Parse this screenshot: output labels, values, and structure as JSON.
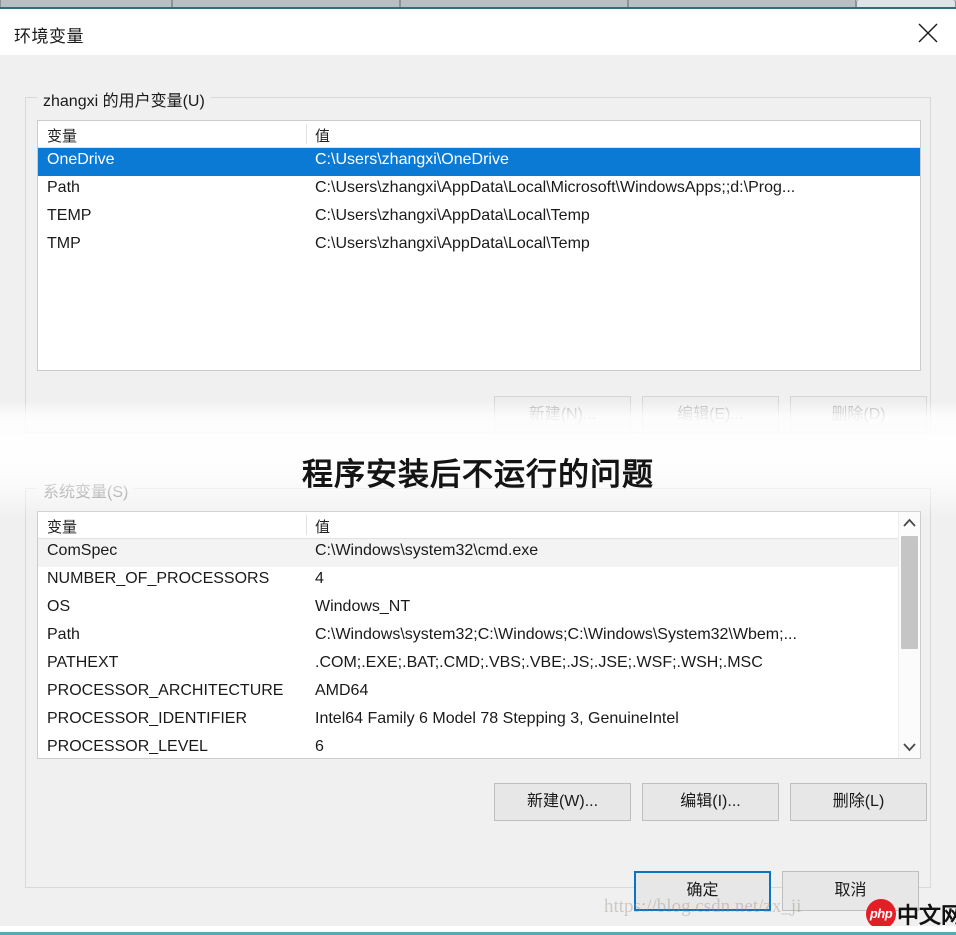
{
  "window": {
    "title": "环境变量",
    "close_icon": "close-icon"
  },
  "user_section": {
    "legend": "zhangxi 的用户变量(U)",
    "columns": [
      "变量",
      "值"
    ],
    "rows": [
      {
        "name": "OneDrive",
        "value": "C:\\Users\\zhangxi\\OneDrive",
        "selected": true
      },
      {
        "name": "Path",
        "value": "C:\\Users\\zhangxi\\AppData\\Local\\Microsoft\\WindowsApps;;d:\\Prog...",
        "selected": false
      },
      {
        "name": "TEMP",
        "value": "C:\\Users\\zhangxi\\AppData\\Local\\Temp",
        "selected": false
      },
      {
        "name": "TMP",
        "value": "C:\\Users\\zhangxi\\AppData\\Local\\Temp",
        "selected": false
      }
    ],
    "buttons": {
      "new": "新建(N)...",
      "edit": "编辑(E)...",
      "delete": "删除(D)"
    }
  },
  "system_section": {
    "legend": "系统变量(S)",
    "columns": [
      "变量",
      "值"
    ],
    "rows": [
      {
        "name": "ComSpec",
        "value": "C:\\Windows\\system32\\cmd.exe",
        "alt": true
      },
      {
        "name": "NUMBER_OF_PROCESSORS",
        "value": "4",
        "alt": false
      },
      {
        "name": "OS",
        "value": "Windows_NT",
        "alt": false
      },
      {
        "name": "Path",
        "value": "C:\\Windows\\system32;C:\\Windows;C:\\Windows\\System32\\Wbem;...",
        "alt": false
      },
      {
        "name": "PATHEXT",
        "value": ".COM;.EXE;.BAT;.CMD;.VBS;.VBE;.JS;.JSE;.WSF;.WSH;.MSC",
        "alt": false
      },
      {
        "name": "PROCESSOR_ARCHITECTURE",
        "value": "AMD64",
        "alt": false
      },
      {
        "name": "PROCESSOR_IDENTIFIER",
        "value": "Intel64 Family 6 Model 78 Stepping 3, GenuineIntel",
        "alt": false
      },
      {
        "name": "PROCESSOR_LEVEL",
        "value": "6",
        "alt": false
      }
    ],
    "buttons": {
      "new": "新建(W)...",
      "edit": "编辑(I)...",
      "delete": "删除(L)"
    },
    "scrollbar": {
      "up_icon": "chevron-up-icon",
      "down_icon": "chevron-down-icon"
    }
  },
  "dialog_buttons": {
    "ok": "确定",
    "cancel": "取消"
  },
  "overlay": {
    "caption": "程序安装后不运行的问题"
  },
  "watermark": {
    "url": "https://blog.csdn.net/zx_ji",
    "badge": "php",
    "site": "中文网"
  },
  "colors": {
    "selection_blue": "#0a7ad4",
    "focus_border": "#0a74c4",
    "dialog_bg": "#f0f0f0",
    "list_bg": "#ffffff",
    "watermark_red": "#e31e24"
  }
}
